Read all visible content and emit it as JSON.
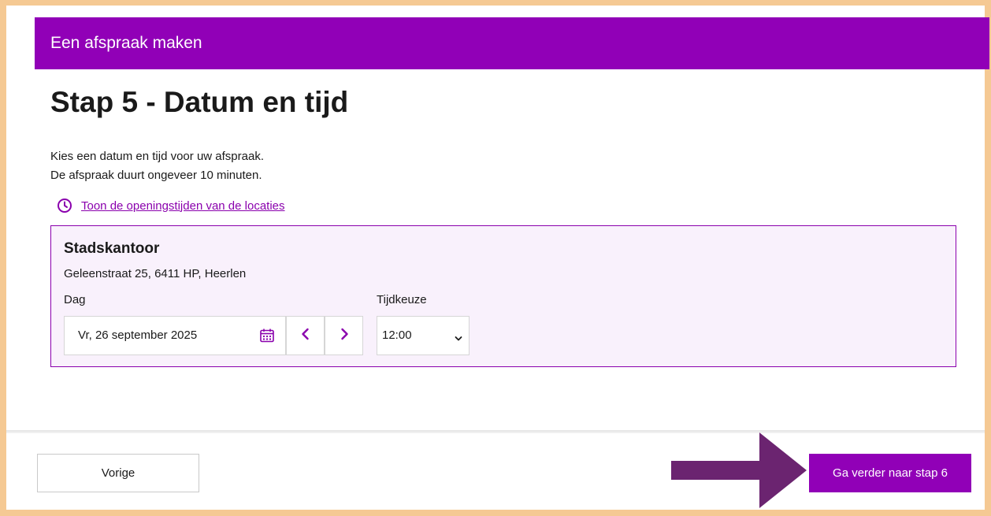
{
  "header": {
    "title": "Een afspraak maken"
  },
  "page": {
    "title": "Stap 5 - Datum en tijd",
    "intro_line1": "Kies een datum en tijd voor uw afspraak.",
    "intro_line2": "De afspraak duurt ongeveer 10 minuten.",
    "hours_link": "Toon de openingstijden van de locaties"
  },
  "location": {
    "name": "Stadskantoor",
    "address": "Geleenstraat 25, 6411 HP, Heerlen",
    "day_label": "Dag",
    "date_value": "Vr, 26 september 2025",
    "time_label": "Tijdkeuze",
    "time_value": "12:00"
  },
  "footer": {
    "prev_label": "Vorige",
    "next_label": "Ga verder naar stap 6"
  },
  "icons": {
    "hours": "clock-icon",
    "calendar": "calendar-icon",
    "prev_day": "chevron-left-icon",
    "next_day": "chevron-right-icon",
    "select": "chevron-down-icon",
    "annotation": "arrow-right-icon"
  },
  "colors": {
    "brand": "#9100b7",
    "accent": "#8a00ad",
    "annotation_arrow": "#6b2470",
    "outer_frame": "#f5c993",
    "location_bg": "#f9f1fc"
  }
}
